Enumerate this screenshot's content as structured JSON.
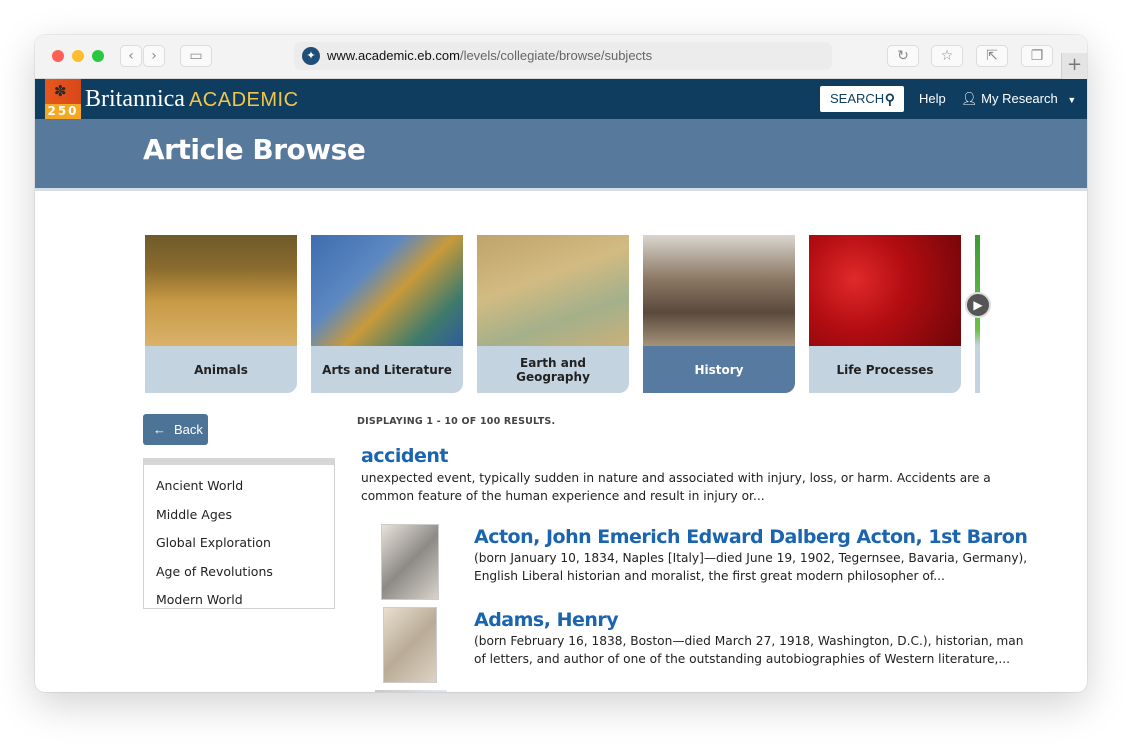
{
  "browser": {
    "url_host": "www.academic.eb.com",
    "url_path": "/levels/collegiate/browse/subjects"
  },
  "header": {
    "brand": "Britannica",
    "brand_sub": "ACADEMIC",
    "logo_number": "250",
    "search_label": "SEARCH",
    "help_label": "Help",
    "research_label": "My Research"
  },
  "page": {
    "title": "Article Browse"
  },
  "subjects": [
    {
      "label": "Animals"
    },
    {
      "label": "Arts and Literature"
    },
    {
      "label": "Earth and Geography"
    },
    {
      "label": "History",
      "active": true
    },
    {
      "label": "Life Processes"
    }
  ],
  "sidebar": {
    "back_label": "Back",
    "items": [
      {
        "label": "Ancient World"
      },
      {
        "label": "Middle Ages"
      },
      {
        "label": "Global Exploration"
      },
      {
        "label": "Age of Revolutions"
      },
      {
        "label": "Modern World"
      }
    ]
  },
  "results": {
    "count_text": "DISPLAYING 1 - 10 OF 100 RESULTS.",
    "items": [
      {
        "title": "accident",
        "desc_line1": "unexpected event, typically sudden in nature and associated with injury, loss, or harm. Accidents are a",
        "desc_line2": "common feature of the human experience and result in injury or..."
      },
      {
        "title": "Acton, John Emerich Edward Dalberg Acton, 1st Baron",
        "desc_line1": "(born January 10, 1834, Naples [Italy]—died June 19, 1902, Tegernsee, Bavaria, Germany),",
        "desc_line2": "English Liberal historian and moralist, the first great modern philosopher of..."
      },
      {
        "title": "Adams, Henry",
        "desc_line1": "(born February 16, 1838, Boston—died March 27, 1918, Washington, D.C.), historian, man",
        "desc_line2": "of letters, and author of one of the outstanding autobiographies of Western literature,..."
      }
    ]
  },
  "colors": {
    "header_bg": "#0e3d5f",
    "band_bg": "#57799c",
    "link": "#1a64b0",
    "active_card": "#567aa0",
    "card_label_bg": "#c4d3e0"
  }
}
